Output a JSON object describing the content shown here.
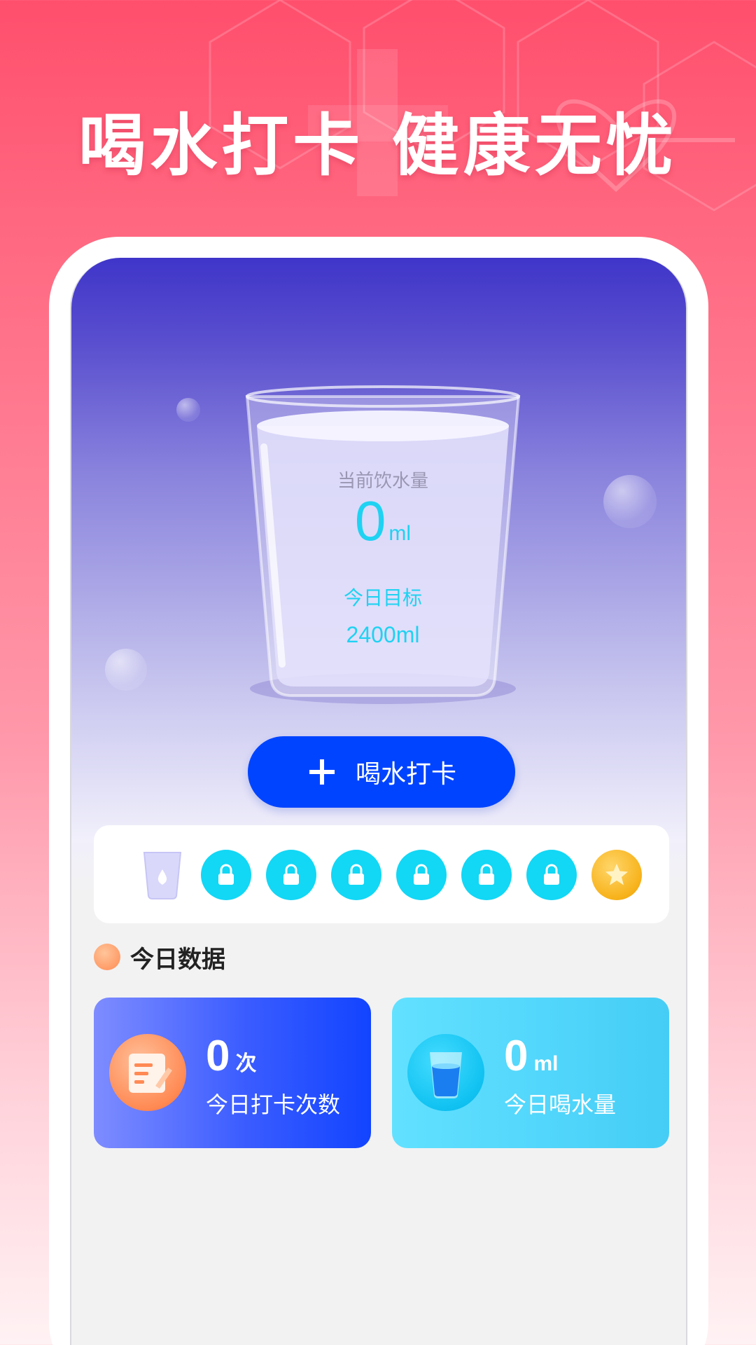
{
  "header": {
    "title": "喝水打卡 健康无忧"
  },
  "glass": {
    "current_label": "当前饮水量",
    "current_value": "0",
    "current_unit": "ml",
    "target_label": "今日目标",
    "target_value": "2400ml"
  },
  "checkin_button": {
    "label": "喝水打卡",
    "icon": "plus-icon"
  },
  "progress": {
    "slots": [
      "water-cup-icon",
      "lock-icon",
      "lock-icon",
      "lock-icon",
      "lock-icon",
      "lock-icon",
      "lock-icon",
      "gold-star-icon"
    ]
  },
  "today": {
    "section_title": "今日数据",
    "checkin_count": {
      "value": "0",
      "unit": "次",
      "label": "今日打卡次数",
      "icon": "notepad-icon"
    },
    "water_amount": {
      "value": "0",
      "unit": "ml",
      "label": "今日喝水量",
      "icon": "water-glass-icon"
    }
  },
  "colors": {
    "accent_blue": "#0044FF",
    "cyan": "#12D7F5",
    "hero_pink": "#FF4F6D"
  }
}
